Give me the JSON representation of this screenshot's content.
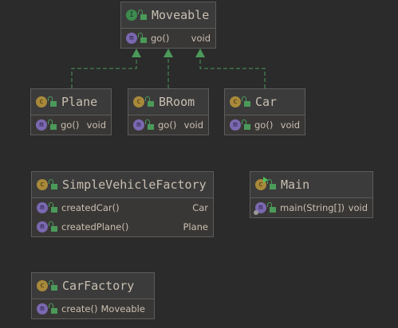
{
  "diagram": {
    "nodes": [
      {
        "id": "moveable",
        "kind": "interface",
        "icon_letter": "I",
        "title": "Moveable",
        "members": [
          {
            "name": "go()",
            "type": "void"
          }
        ]
      },
      {
        "id": "plane",
        "kind": "class",
        "icon_letter": "c",
        "title": "Plane",
        "members": [
          {
            "name": "go()",
            "type": "void"
          }
        ]
      },
      {
        "id": "broom",
        "kind": "class",
        "icon_letter": "c",
        "title": "BRoom",
        "members": [
          {
            "name": "go()",
            "type": "void"
          }
        ]
      },
      {
        "id": "car",
        "kind": "class",
        "icon_letter": "c",
        "title": "Car",
        "members": [
          {
            "name": "go()",
            "type": "void"
          }
        ]
      },
      {
        "id": "svf",
        "kind": "class",
        "icon_letter": "c",
        "title": "SimpleVehicleFactory",
        "members": [
          {
            "name": "createdCar()",
            "type": "Car"
          },
          {
            "name": "createdPlane()",
            "type": "Plane"
          }
        ]
      },
      {
        "id": "main",
        "kind": "class",
        "icon_letter": "c",
        "title": "Main",
        "members": [
          {
            "name": "main(String[])",
            "type": "void"
          }
        ]
      },
      {
        "id": "carfactory",
        "kind": "class",
        "icon_letter": "c",
        "title": "CarFactory",
        "members": [
          {
            "name": "create()",
            "type": "Moveable"
          }
        ]
      }
    ],
    "method_icon_letter": "m",
    "edges": [
      {
        "from": "plane",
        "to": "moveable",
        "type": "implements"
      },
      {
        "from": "broom",
        "to": "moveable",
        "type": "implements"
      },
      {
        "from": "car",
        "to": "moveable",
        "type": "implements"
      }
    ],
    "colors": {
      "background": "#2b2b2b",
      "edge": "#4b9a5a",
      "interface": "#3c8c4e",
      "class": "#a8893a",
      "method": "#7a68b0"
    }
  }
}
